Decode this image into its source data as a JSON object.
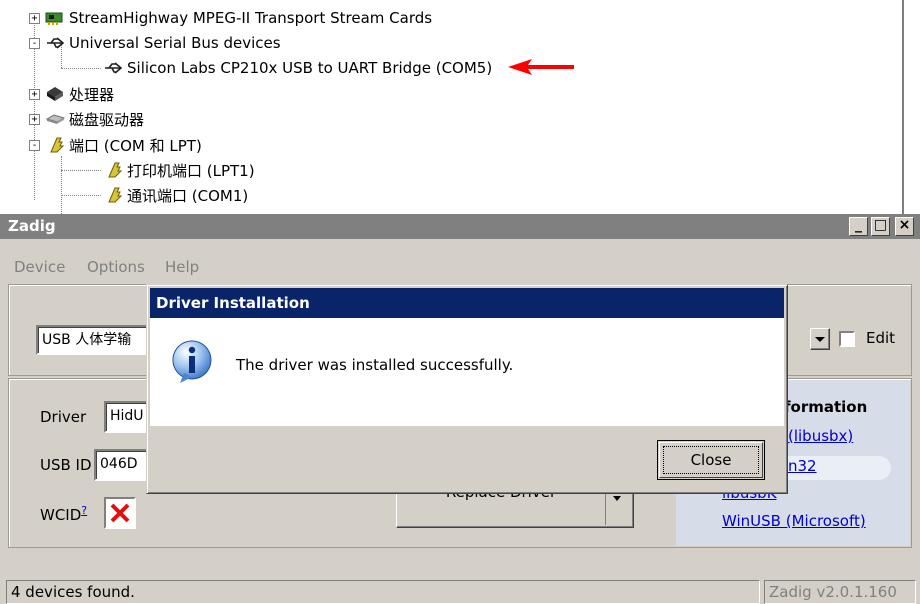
{
  "device_tree": {
    "items": [
      {
        "label": "StreamHighway MPEG-II Transport Stream Cards",
        "icon": "network-card-icon",
        "expander": "+"
      },
      {
        "label": "Universal Serial Bus devices",
        "icon": "usb-icon",
        "expander": "-"
      },
      {
        "label": "Silicon Labs CP210x USB to UART Bridge (COM5)",
        "icon": "usb-icon"
      },
      {
        "label": "处理器",
        "icon": "processor-icon",
        "expander": "+"
      },
      {
        "label": "磁盘驱动器",
        "icon": "disk-drive-icon",
        "expander": "+"
      },
      {
        "label": "端口 (COM 和 LPT)",
        "icon": "port-icon",
        "expander": "-"
      },
      {
        "label": "打印机端口 (LPT1)",
        "icon": "port-icon"
      },
      {
        "label": "通讯端口 (COM1)",
        "icon": "port-icon"
      }
    ],
    "annotation_color": "#ff0000"
  },
  "zadig": {
    "title": "Zadig",
    "menu": [
      "Device",
      "Options",
      "Help"
    ],
    "device_select": "USB 人体学输",
    "edit_label": "Edit",
    "driver_label": "Driver",
    "driver_value": "HidU",
    "usbid_label": "USB ID",
    "usbid_value": "046D",
    "wcid_label": "WCID",
    "wcid_sup": "?",
    "replace_button": "Replace Driver",
    "info_title": "formation",
    "links": [
      "(libusbx)",
      "n32",
      "libusbK",
      "WinUSB (Microsoft)"
    ],
    "status_left": "4 devices found.",
    "status_right": "Zadig v2.0.1.160"
  },
  "dialog": {
    "title": "Driver Installation",
    "message": "The driver was installed successfully.",
    "close_button": "Close",
    "title_color": "#0a246a"
  }
}
